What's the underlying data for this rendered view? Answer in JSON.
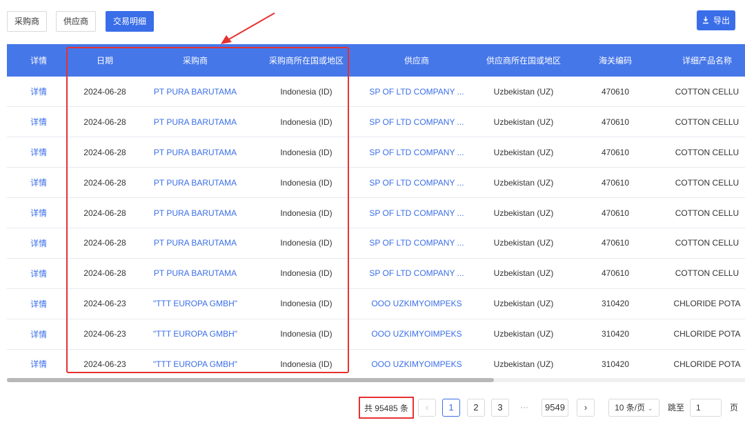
{
  "tabs": [
    {
      "label": "采购商"
    },
    {
      "label": "供应商"
    },
    {
      "label": "交易明细"
    }
  ],
  "export": {
    "label": "导出",
    "icon": "download-icon"
  },
  "table": {
    "headers": [
      "详情",
      "日期",
      "采购商",
      "采购商所在国或地区",
      "供应商",
      "供应商所在国或地区",
      "海关编码",
      "详细产品名称"
    ],
    "rows": [
      [
        "详情",
        "2024-06-28",
        "PT PURA BARUTAMA",
        "Indonesia (ID)",
        "SP OF LTD COMPANY ...",
        "Uzbekistan (UZ)",
        "470610",
        "COTTON CELLU"
      ],
      [
        "详情",
        "2024-06-28",
        "PT PURA BARUTAMA",
        "Indonesia (ID)",
        "SP OF LTD COMPANY ...",
        "Uzbekistan (UZ)",
        "470610",
        "COTTON CELLU"
      ],
      [
        "详情",
        "2024-06-28",
        "PT PURA BARUTAMA",
        "Indonesia (ID)",
        "SP OF LTD COMPANY ...",
        "Uzbekistan (UZ)",
        "470610",
        "COTTON CELLU"
      ],
      [
        "详情",
        "2024-06-28",
        "PT PURA BARUTAMA",
        "Indonesia (ID)",
        "SP OF LTD COMPANY ...",
        "Uzbekistan (UZ)",
        "470610",
        "COTTON CELLU"
      ],
      [
        "详情",
        "2024-06-28",
        "PT PURA BARUTAMA",
        "Indonesia (ID)",
        "SP OF LTD COMPANY ...",
        "Uzbekistan (UZ)",
        "470610",
        "COTTON CELLU"
      ],
      [
        "详情",
        "2024-06-28",
        "PT PURA BARUTAMA",
        "Indonesia (ID)",
        "SP OF LTD COMPANY ...",
        "Uzbekistan (UZ)",
        "470610",
        "COTTON CELLU"
      ],
      [
        "详情",
        "2024-06-28",
        "PT PURA BARUTAMA",
        "Indonesia (ID)",
        "SP OF LTD COMPANY ...",
        "Uzbekistan (UZ)",
        "470610",
        "COTTON CELLU"
      ],
      [
        "详情",
        "2024-06-23",
        "\"TTT EUROPA GMBH\"",
        "Indonesia (ID)",
        "OOO UZKIMYOIMPEKS",
        "Uzbekistan (UZ)",
        "310420",
        "CHLORIDE POTA"
      ],
      [
        "详情",
        "2024-06-23",
        "\"TTT EUROPA GMBH\"",
        "Indonesia (ID)",
        "OOO UZKIMYOIMPEKS",
        "Uzbekistan (UZ)",
        "310420",
        "CHLORIDE POTA"
      ],
      [
        "详情",
        "2024-06-23",
        "\"TTT EUROPA GMBH\"",
        "Indonesia (ID)",
        "OOO UZKIMYOIMPEKS",
        "Uzbekistan (UZ)",
        "310420",
        "CHLORIDE POTA"
      ]
    ]
  },
  "pagination": {
    "total": "共 95485 条",
    "prev_icon": "chevron-left-icon",
    "pages": [
      "1",
      "2",
      "3"
    ],
    "ellipsis": "···",
    "last_page": "9549",
    "next_icon": "chevron-right-icon",
    "page_size": "10 条/页",
    "jump_label": "跳至",
    "jump_value": "1",
    "page_label": "页"
  },
  "colors": {
    "accent": "#3a6ee8",
    "header_bg": "#4677e9",
    "highlight": "#e63030"
  }
}
